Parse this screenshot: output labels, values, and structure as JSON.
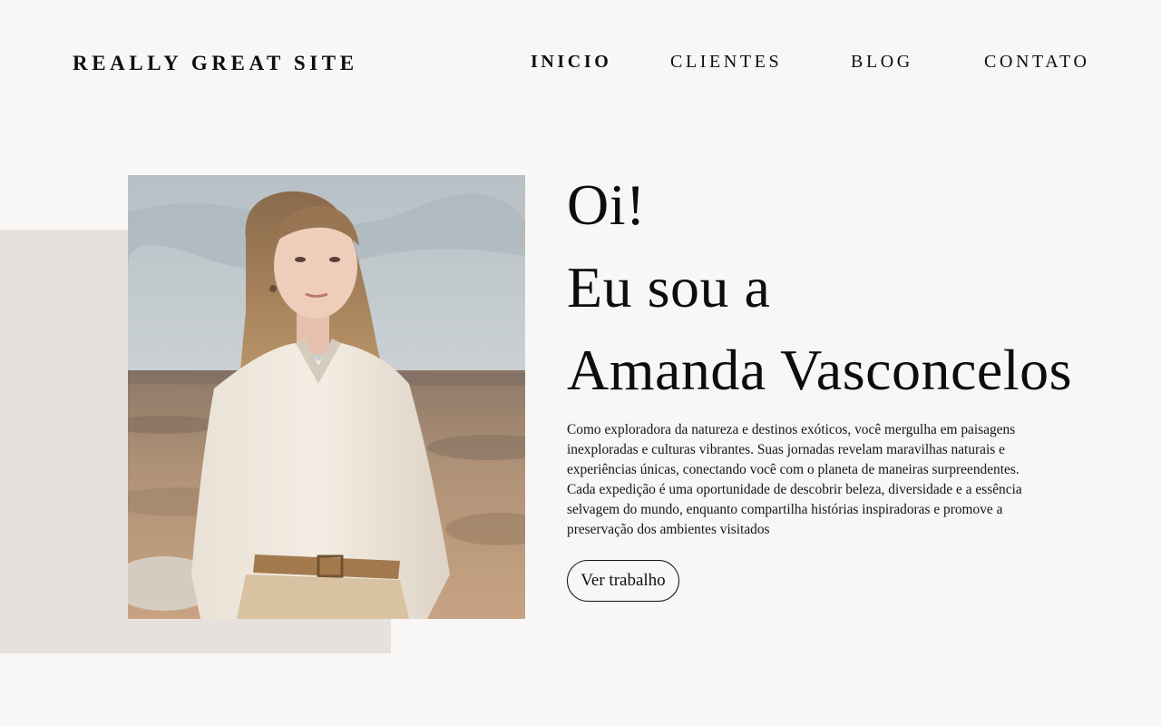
{
  "header": {
    "logo": "REALLY GREAT SITE",
    "nav": [
      {
        "label": "INICIO",
        "active": true
      },
      {
        "label": "CLIENTES",
        "active": false
      },
      {
        "label": "BLOG",
        "active": false
      },
      {
        "label": "CONTATO",
        "active": false
      }
    ]
  },
  "hero": {
    "title_lines": [
      "Oi!",
      "Eu sou a",
      "Amanda Vasconcelos"
    ],
    "bio": "Como exploradora da natureza e destinos exóticos, você mergulha em paisagens inexploradas e culturas vibrantes. Suas jornadas revelam maravilhas naturais e experiências únicas, conectando você com o planeta de maneiras surpreendentes. Cada expedição é uma oportunidade de descobrir beleza, diversidade e a essência selvagem do mundo, enquanto compartilha histórias inspiradoras e promove a preservação dos ambientes visitados",
    "cta_label": "Ver trabalho"
  },
  "colors": {
    "background": "#f9f7f5",
    "accent_block": "#e7e1dd",
    "text": "#0d0d0d"
  }
}
